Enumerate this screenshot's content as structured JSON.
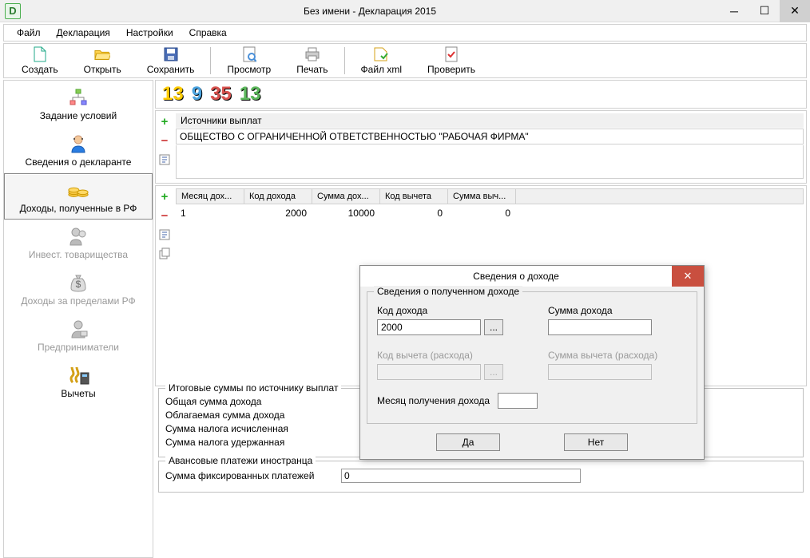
{
  "window": {
    "title": "Без имени - Декларация 2015"
  },
  "menu": {
    "file": "Файл",
    "declaration": "Декларация",
    "settings": "Настройки",
    "help": "Справка"
  },
  "toolbar": {
    "create": "Создать",
    "open": "Открыть",
    "save": "Сохранить",
    "preview": "Просмотр",
    "print": "Печать",
    "filexml": "Файл xml",
    "check": "Проверить"
  },
  "sidebar": {
    "conditions": "Задание условий",
    "declarant": "Сведения о декларанте",
    "income_rf": "Доходы, полученные в РФ",
    "invest": "Инвест. товарищества",
    "income_abroad": "Доходы за пределами РФ",
    "entrepreneur": "Предприниматели",
    "deductions": "Вычеты"
  },
  "numbers": {
    "a": "13",
    "b": "9",
    "c": "35",
    "d": "13"
  },
  "sources": {
    "label": "Источники выплат",
    "item": "ОБЩЕСТВО С ОГРАНИЧЕННОЙ ОТВЕТСТВЕННОСТЬЮ \"РАБОЧАЯ ФИРМА\""
  },
  "table": {
    "headers": {
      "month": "Месяц дох...",
      "code": "Код дохода",
      "sum": "Сумма дох...",
      "dcode": "Код вычета",
      "dsum": "Сумма выч..."
    },
    "row": {
      "month": "1",
      "code": "2000",
      "sum": "10000",
      "dcode": "0",
      "dsum": "0"
    }
  },
  "totals": {
    "legend": "Итоговые суммы по источнику выплат",
    "total_income": "Общая сумма дохода",
    "taxable_income": "Облагаемая сумма дохода",
    "tax_calc": "Сумма налога исчисленная",
    "tax_withheld": "Сумма налога удержанная"
  },
  "advance": {
    "legend": "Авансовые платежи иностранца",
    "fixed": "Сумма фиксированных платежей",
    "value": "0"
  },
  "dialog": {
    "title": "Сведения о доходе",
    "group": "Сведения о полученном доходе",
    "code_label": "Код дохода",
    "code_value": "2000",
    "sum_label": "Сумма дохода",
    "sum_value": "",
    "dcode_label": "Код вычета (расхода)",
    "dsum_label": "Сумма вычета (расхода)",
    "month_label": "Месяц получения дохода",
    "month_value": "",
    "ok": "Да",
    "cancel": "Нет"
  }
}
